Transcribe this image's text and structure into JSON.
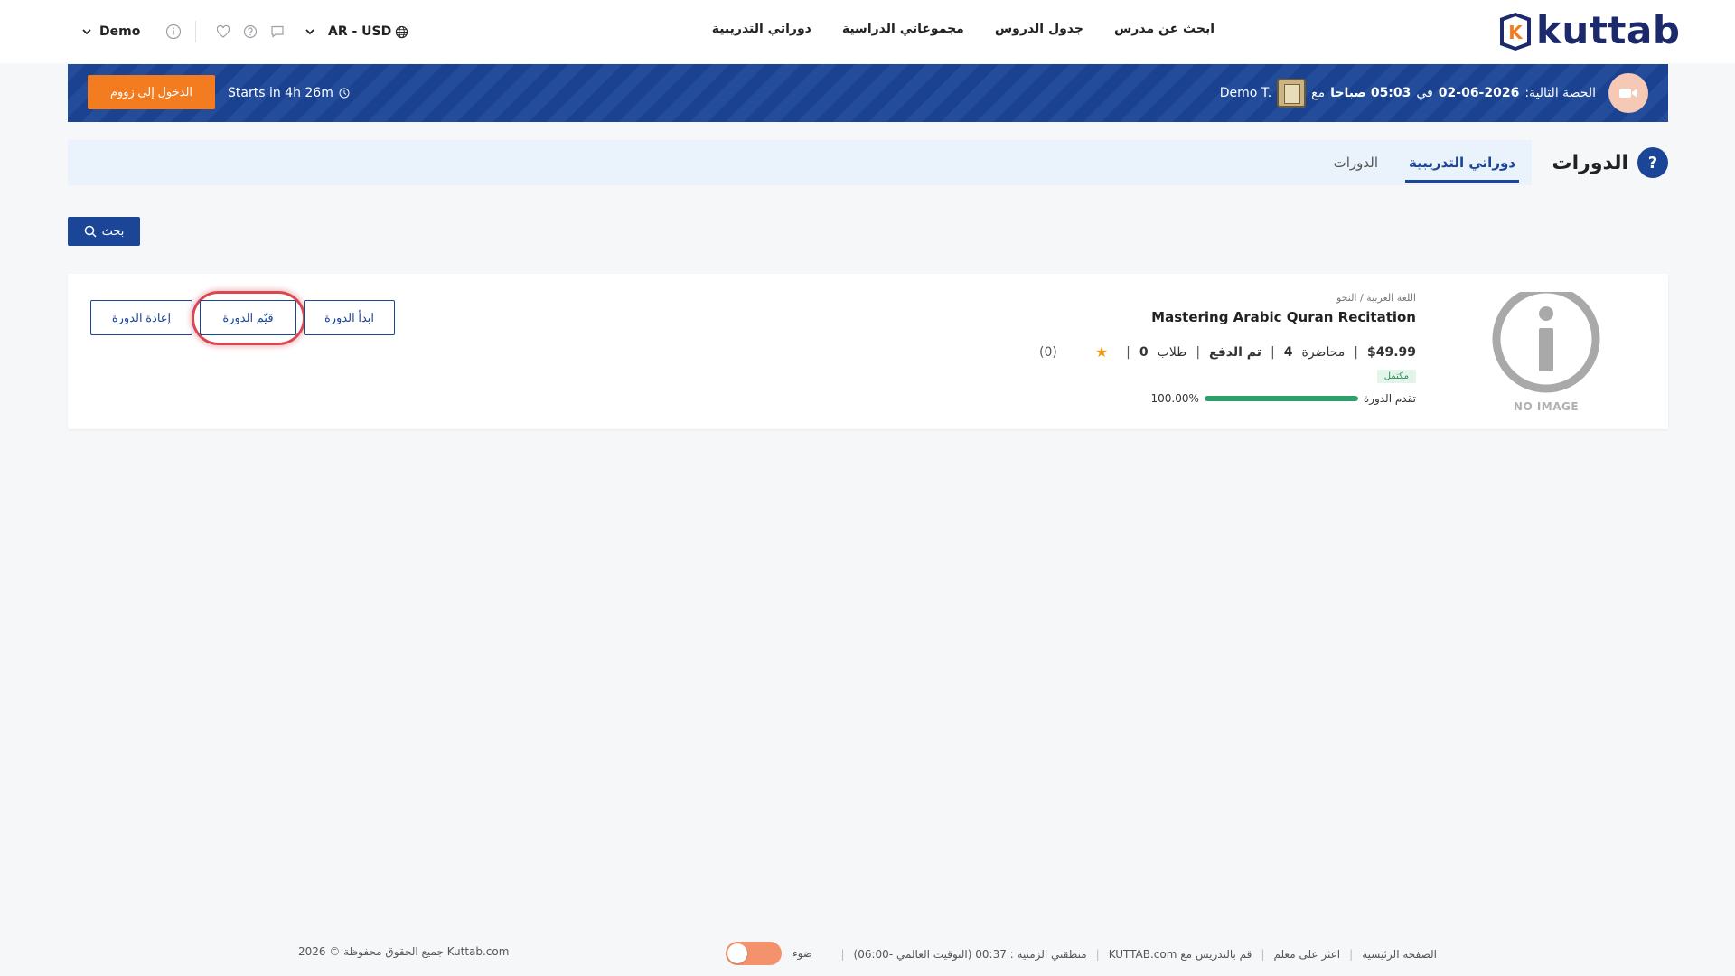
{
  "header": {
    "brand": "kuttab",
    "logo_letter": "K",
    "nav": [
      "ابحث عن مدرس",
      "جدول الدروس",
      "مجموعاتي الدراسية",
      "دوراتي التدريبية"
    ],
    "currency": "AR - USD",
    "user_name": "Demo"
  },
  "banner": {
    "next_lesson_label": "الحصة التالية:",
    "next_lesson_date": "02-06-2026",
    "at_word": "في",
    "next_lesson_time": "05:03 صباحا",
    "with_word": "مع",
    "teacher": "Demo T.",
    "starts_in": "Starts in 4h 26m",
    "zoom_button": "الدخول إلى زووم"
  },
  "page": {
    "title": "الدورات",
    "title_icon": "?",
    "tabs": [
      {
        "label": "دوراتي التدريبية",
        "active": true
      },
      {
        "label": "الدورات",
        "active": false
      }
    ],
    "search_button": "بحث"
  },
  "course": {
    "breadcrumb": "اللغة العربية / النحو",
    "title": "Mastering Arabic Quran Recitation",
    "price": "$49.99",
    "lectures_label": "محاضرة",
    "lectures_count": "4",
    "payment_status": "تم الدفع",
    "students_label": "طلاب",
    "students_count": "0",
    "rating_count": "(0)",
    "status_badge": "مكتمل",
    "progress_label": "تقدم الدورة",
    "progress_value": 1.0,
    "progress_text": "100.00%",
    "no_image_text": "NO IMAGE AVAILABLE",
    "actions": {
      "start": "ابدأ الدورة",
      "rate": "قيّم الدورة",
      "restart": "إعادة الدورة"
    }
  },
  "footer": {
    "links": [
      "الصفحة الرئيسية",
      "اعثر على معلم",
      "قم بالتدريس مع KUTTAB.com",
      "منطقتي الزمنية : 00:37 (التوقيت العالمي -06:00)"
    ],
    "theme_label": "ضوء",
    "copyright": "جميع الحقوق محفوظة © 2026 Kuttab.com"
  },
  "colors": {
    "primary": "#1b4596",
    "accent_orange": "#f47c20",
    "success": "#2e9e6b",
    "highlight_ring": "#d9474f"
  }
}
